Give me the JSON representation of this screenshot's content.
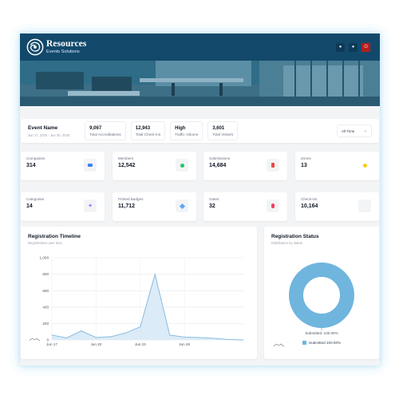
{
  "brand": {
    "title": "Resources",
    "subtitle": "Events Solutions"
  },
  "header": {
    "actions": [
      {
        "icon": "bell-icon"
      },
      {
        "icon": "user-icon"
      },
      {
        "icon": "power-icon"
      }
    ]
  },
  "event": {
    "name": "Event Name",
    "dates": "Jun 17, 2025 - Jun 30, 2025",
    "stats": [
      {
        "value": "9,067",
        "label": "Total Accreditations"
      },
      {
        "value": "12,943",
        "label": "Total Check-ins"
      },
      {
        "value": "High",
        "label": "Traffic Volume"
      },
      {
        "value": "3,601",
        "label": "Total Visitors"
      }
    ],
    "range": {
      "selected": "All Time"
    }
  },
  "metrics": [
    {
      "label": "Companies",
      "value": "314",
      "icon": "card-icon",
      "color": "#3b82f6"
    },
    {
      "label": "Members",
      "value": "12,542",
      "icon": "members-icon",
      "color": "#22c55e"
    },
    {
      "label": "Submissions",
      "value": "14,684",
      "icon": "document-icon",
      "color": "#ef4444"
    },
    {
      "label": "Zones",
      "value": "13",
      "icon": "zones-icon",
      "color": "#facc15"
    },
    {
      "label": "Categories",
      "value": "14",
      "icon": "share-icon",
      "color": "#8b5cf6"
    },
    {
      "label": "Printed Badges",
      "value": "11,712",
      "icon": "badge-icon",
      "color": "#60a5fa"
    },
    {
      "label": "Gates",
      "value": "32",
      "icon": "pin-icon",
      "color": "#f43f5e"
    },
    {
      "label": "Check-ins",
      "value": "10,164",
      "icon": "checkin-icon",
      "color": "#9ca3af"
    }
  ],
  "timeline": {
    "title": "Registration Timeline",
    "subtitle": "Registrations over time"
  },
  "status": {
    "title": "Registration Status",
    "subtitle": "Distribution by status",
    "slice_label": "Submitted: 100.00%",
    "legend": "Submitted 100.00%"
  },
  "colors": {
    "header": "#12496b",
    "accent": "#6fb5de",
    "background": "#f3f4f6"
  },
  "chart_data": [
    {
      "type": "area",
      "title": "Registration Timeline",
      "subtitle": "Registrations over time",
      "x": [
        "Jun 17",
        "Jun 18",
        "Jun 19",
        "Jun 20",
        "Jun 21",
        "Jun 22",
        "Jun 23",
        "Jun 24",
        "Jun 25",
        "Jun 26",
        "Jun 27",
        "Jun 28",
        "Jun 29",
        "Jun 30"
      ],
      "values": [
        60,
        25,
        110,
        30,
        40,
        85,
        160,
        800,
        60,
        35,
        30,
        20,
        5,
        0
      ],
      "x_ticks": [
        "Jun 17",
        "Jun 20",
        "Jun 23",
        "Jun 26"
      ],
      "y_ticks": [
        0,
        200,
        400,
        600,
        800,
        1000
      ],
      "ylim": [
        0,
        1000
      ],
      "grid": true
    },
    {
      "type": "pie",
      "title": "Registration Status",
      "subtitle": "Distribution by status",
      "labels": [
        "Submitted"
      ],
      "values": [
        100.0
      ],
      "legend": "bottom"
    }
  ]
}
